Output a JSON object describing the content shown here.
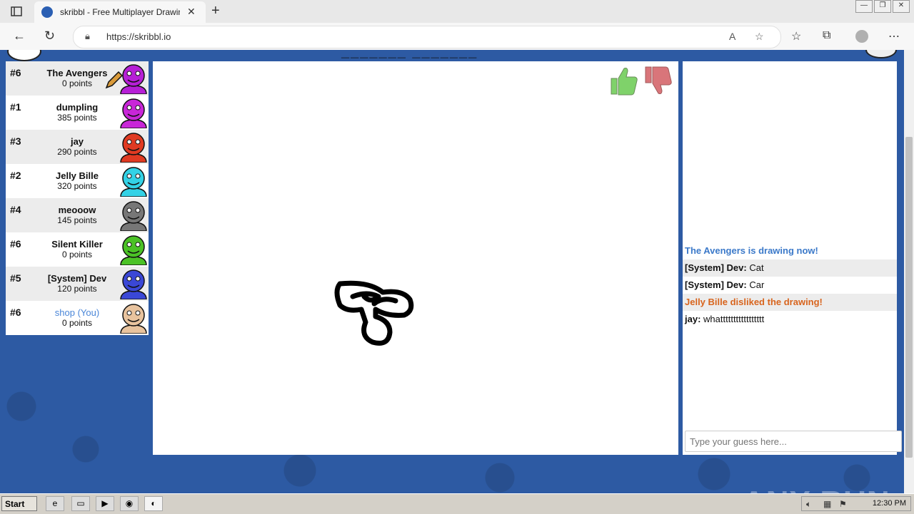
{
  "browser": {
    "tab_title": "skribbl - Free Multiplayer Drawing",
    "tab_close": "✕",
    "new_tab": "+",
    "url": "https://skribbl.io",
    "min": "—",
    "max": "❐",
    "close": "✕"
  },
  "game": {
    "word_hint": "_______  _______"
  },
  "players": [
    {
      "rank": "#6",
      "name": "The Avengers",
      "score": "0 points",
      "color": "#b61fd6",
      "drawing": true,
      "you": false
    },
    {
      "rank": "#1",
      "name": "dumpling",
      "score": "385 points",
      "color": "#c826d8",
      "drawing": false,
      "you": false
    },
    {
      "rank": "#3",
      "name": "jay",
      "score": "290 points",
      "color": "#e03a22",
      "drawing": false,
      "you": false
    },
    {
      "rank": "#2",
      "name": "Jelly Bille",
      "score": "320 points",
      "color": "#33d2e6",
      "drawing": false,
      "you": false
    },
    {
      "rank": "#4",
      "name": "meooow",
      "score": "145 points",
      "color": "#777777",
      "drawing": false,
      "you": false
    },
    {
      "rank": "#6",
      "name": "Silent Killer",
      "score": "0 points",
      "color": "#4bc226",
      "drawing": false,
      "you": false
    },
    {
      "rank": "#5",
      "name": "[System] Dev",
      "score": "120 points",
      "color": "#3a47d6",
      "drawing": false,
      "you": false
    },
    {
      "rank": "#6",
      "name": "shop (You)",
      "score": "0 points",
      "color": "#e8c39e",
      "drawing": false,
      "you": true
    }
  ],
  "bubbles": {
    "jay_message": "whattttttttttttttttt"
  },
  "chat": {
    "messages": [
      {
        "type": "system",
        "color": "#3b79c9",
        "text": "The Avengers is drawing now!"
      },
      {
        "type": "user",
        "who": "[System] Dev:",
        "text": "Cat"
      },
      {
        "type": "user",
        "who": "[System] Dev:",
        "text": "Car"
      },
      {
        "type": "system",
        "color": "#d8641d",
        "text": "Jelly Bille disliked the drawing!"
      },
      {
        "type": "user",
        "who": "jay:",
        "text": "whattttttttttttttttt"
      }
    ],
    "input_placeholder": "Type your guess here..."
  },
  "watermark": "ANY RUN",
  "taskbar": {
    "start": "Start",
    "clock": "12:30 PM"
  },
  "colors": {
    "page_bg": "#2d5aa3",
    "like": "#7fd26a",
    "dislike": "#d9757a"
  }
}
